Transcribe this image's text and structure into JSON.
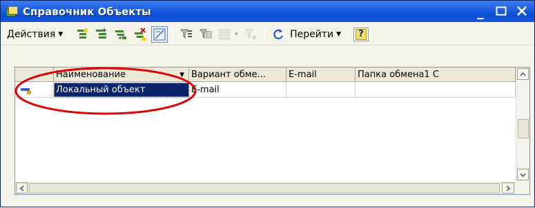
{
  "window": {
    "title": "Справочник Объекты",
    "controls": {
      "minimize": "_",
      "maximize": "□",
      "close": "✕"
    }
  },
  "toolbar": {
    "actions_label": "Действия",
    "goto_label": "Перейти",
    "help_label": "?",
    "buttons": [
      {
        "icon": "add-item-icon",
        "enabled": true
      },
      {
        "icon": "add-group-icon",
        "enabled": true
      },
      {
        "icon": "copy-item-icon",
        "enabled": true
      },
      {
        "icon": "delete-mark-icon",
        "enabled": true
      },
      {
        "icon": "hierarchy-toggle-icon",
        "enabled": true,
        "pressed": true
      },
      {
        "icon": "filter-icon",
        "enabled": true
      },
      {
        "icon": "filter-by-value-icon",
        "enabled": true
      },
      {
        "icon": "filter-history-icon",
        "enabled": false
      },
      {
        "icon": "clear-filter-icon",
        "enabled": false
      },
      {
        "icon": "refresh-icon",
        "enabled": true
      }
    ]
  },
  "table": {
    "columns": [
      {
        "label": ""
      },
      {
        "label": "Наименование",
        "sorted": true
      },
      {
        "label": "Вариант обме..."
      },
      {
        "label": "E-mail"
      },
      {
        "label": "Папка обмена1 С"
      }
    ],
    "rows": [
      {
        "icon": "catalog-item-icon",
        "cells": [
          "Локальный объект",
          "E-mail",
          "",
          ""
        ],
        "selected_col": 0
      }
    ]
  },
  "colors": {
    "title_bar": "#1f5fe0",
    "selection": "#0a246a",
    "annotation": "#e00000"
  }
}
